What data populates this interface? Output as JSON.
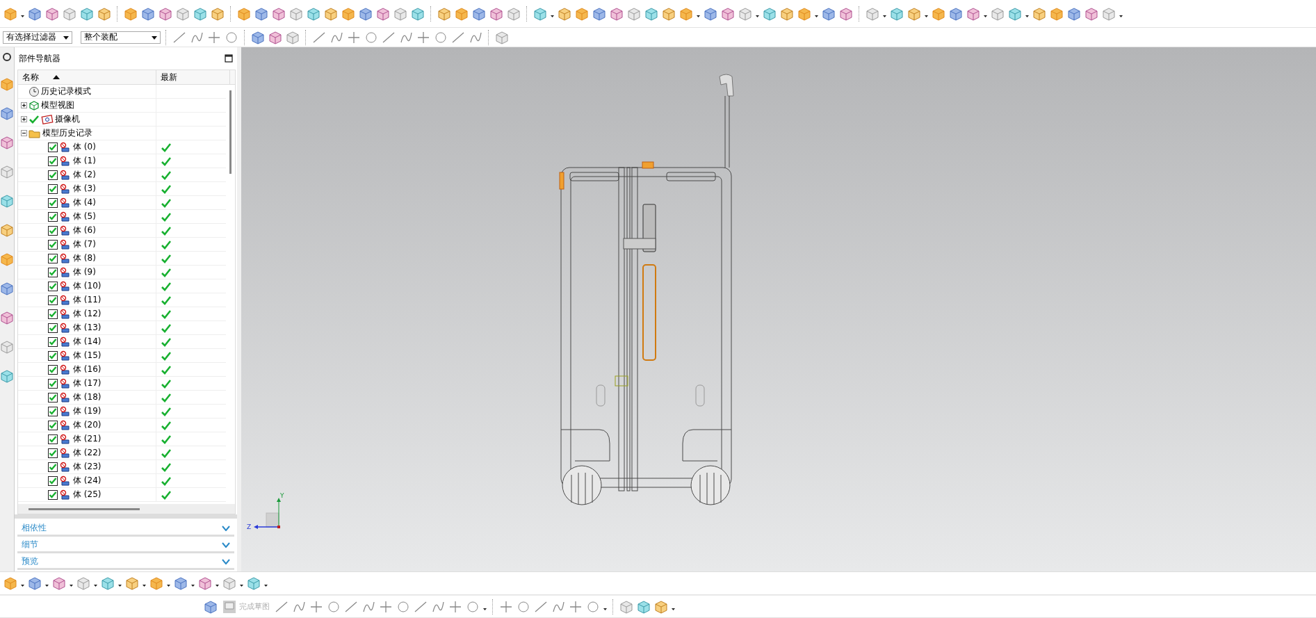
{
  "filters": [
    {
      "value": "有选择过滤器"
    },
    {
      "value": "整个装配"
    }
  ],
  "navigator": {
    "title": "部件导航器",
    "columns": [
      "名称",
      "最新"
    ],
    "tree": [
      {
        "label": "历史记录模式",
        "kind": "clock"
      },
      {
        "label": "模型视图",
        "kind": "views",
        "expanded": false
      },
      {
        "label": "摄像机",
        "kind": "camera",
        "expanded": false,
        "checked": true
      },
      {
        "label": "模型历史记录",
        "kind": "folder",
        "expanded": true,
        "children": [
          {
            "label": "体 (0)",
            "kind": "body",
            "checked": true,
            "latest": true
          },
          {
            "label": "体 (1)",
            "kind": "body",
            "checked": true,
            "latest": true
          },
          {
            "label": "体 (2)",
            "kind": "body",
            "checked": true,
            "latest": true
          },
          {
            "label": "体 (3)",
            "kind": "body",
            "checked": true,
            "latest": true
          },
          {
            "label": "体 (4)",
            "kind": "body",
            "checked": true,
            "latest": true
          },
          {
            "label": "体 (5)",
            "kind": "body",
            "checked": true,
            "latest": true
          },
          {
            "label": "体 (6)",
            "kind": "body",
            "checked": true,
            "latest": true
          },
          {
            "label": "体 (7)",
            "kind": "body",
            "checked": true,
            "latest": true
          },
          {
            "label": "体 (8)",
            "kind": "body",
            "checked": true,
            "latest": true
          },
          {
            "label": "体 (9)",
            "kind": "body",
            "checked": true,
            "latest": true
          },
          {
            "label": "体 (10)",
            "kind": "body",
            "checked": true,
            "latest": true
          },
          {
            "label": "体 (11)",
            "kind": "body",
            "checked": true,
            "latest": true
          },
          {
            "label": "体 (12)",
            "kind": "body",
            "checked": true,
            "latest": true
          },
          {
            "label": "体 (13)",
            "kind": "body",
            "checked": true,
            "latest": true
          },
          {
            "label": "体 (14)",
            "kind": "body",
            "checked": true,
            "latest": true
          },
          {
            "label": "体 (15)",
            "kind": "body",
            "checked": true,
            "latest": true
          },
          {
            "label": "体 (16)",
            "kind": "body",
            "checked": true,
            "latest": true
          },
          {
            "label": "体 (17)",
            "kind": "body",
            "checked": true,
            "latest": true
          },
          {
            "label": "体 (18)",
            "kind": "body",
            "checked": true,
            "latest": true
          },
          {
            "label": "体 (19)",
            "kind": "body",
            "checked": true,
            "latest": true
          },
          {
            "label": "体 (20)",
            "kind": "body",
            "checked": true,
            "latest": true
          },
          {
            "label": "体 (21)",
            "kind": "body",
            "checked": true,
            "latest": true
          },
          {
            "label": "体 (22)",
            "kind": "body",
            "checked": true,
            "latest": true
          },
          {
            "label": "体 (23)",
            "kind": "body",
            "checked": true,
            "latest": true
          },
          {
            "label": "体 (24)",
            "kind": "body",
            "checked": true,
            "latest": true
          },
          {
            "label": "体 (25)",
            "kind": "body",
            "checked": true,
            "latest": true
          }
        ]
      }
    ],
    "sections": [
      {
        "label": "相依性",
        "expanded": false
      },
      {
        "label": "细节",
        "expanded": false
      },
      {
        "label": "预览",
        "expanded": false
      }
    ]
  },
  "viewport": {
    "triad": {
      "y": "Y",
      "z": "Z"
    }
  },
  "sketch_toolbar": {
    "finish": {
      "label": "完成草图",
      "disabled": true
    }
  }
}
